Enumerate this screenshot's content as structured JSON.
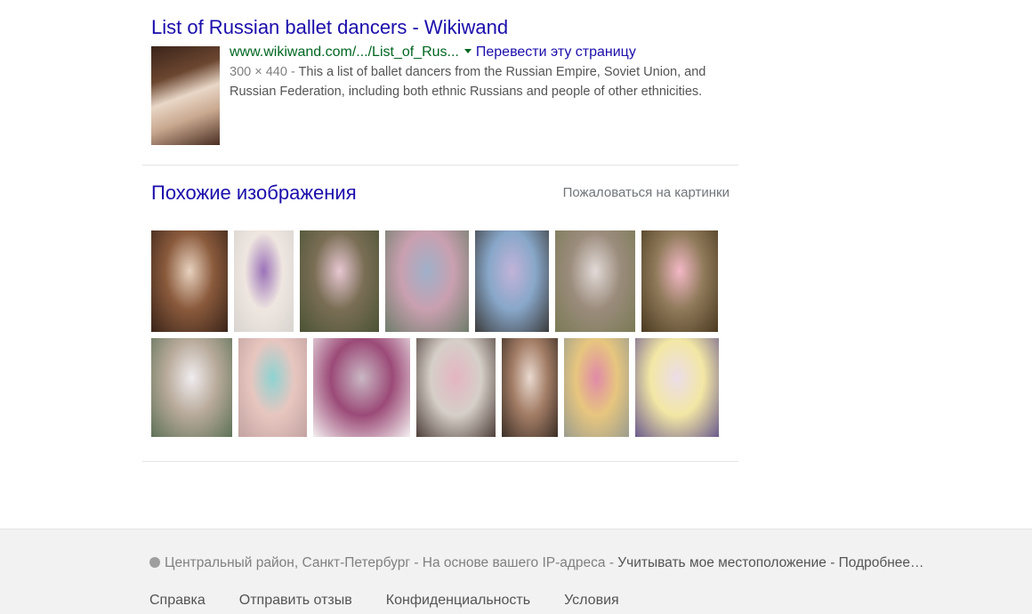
{
  "result": {
    "title": "List of Russian ballet dancers - Wikiwand",
    "url": "www.wikiwand.com/.../List_of_Rus...",
    "translate_label": "Перевести эту страницу",
    "dimensions": "300 × 440",
    "separator": " - ",
    "snippet": "This a list of ballet dancers from the Russian Empire, Soviet Union, and Russian Federation, including both ethnic Russians and people of other ethnicities."
  },
  "similar": {
    "title": "Похожие изображения",
    "report_label": "Пожаловаться на картинки",
    "row1": [
      {
        "name": "ballerina-thumb-1",
        "w": 86,
        "c": [
          "#3a2419",
          "#e8d2bf",
          "#8a5a3c"
        ]
      },
      {
        "name": "ballerina-thumb-2",
        "w": 67,
        "c": [
          "#d8d4d0",
          "#9b73b8",
          "#efe6e0"
        ]
      },
      {
        "name": "ballerina-thumb-3",
        "w": 89,
        "c": [
          "#4b5335",
          "#e7c7d2",
          "#7a6e55"
        ]
      },
      {
        "name": "ballerina-thumb-4",
        "w": 94,
        "c": [
          "#6f7d6b",
          "#9fb0c9",
          "#c9a0b0"
        ]
      },
      {
        "name": "ballerina-thumb-5",
        "w": 83,
        "c": [
          "#3b3b3b",
          "#c2b3d9",
          "#88a7c9"
        ]
      },
      {
        "name": "ballerina-thumb-6",
        "w": 90,
        "c": [
          "#7a7a55",
          "#e2dad8",
          "#9b8c7c"
        ]
      },
      {
        "name": "ballerina-thumb-7",
        "w": 86,
        "c": [
          "#4b3a20",
          "#f3b8c6",
          "#8f7a5a"
        ]
      }
    ],
    "row2": [
      {
        "name": "ballerina-thumb-8",
        "w": 91,
        "c": [
          "#5e7257",
          "#f0ecef",
          "#b8aa9a"
        ]
      },
      {
        "name": "ballerina-thumb-9",
        "w": 77,
        "c": [
          "#c2a3a0",
          "#8ed3d2",
          "#e8c6c0"
        ]
      },
      {
        "name": "ballerina-thumb-10",
        "w": 109,
        "c": [
          "#f4f0f0",
          "#c9b8c4",
          "#9b4a77"
        ]
      },
      {
        "name": "ballerina-thumb-11",
        "w": 89,
        "c": [
          "#4e3e3a",
          "#e4b5c2",
          "#d6cfc8"
        ]
      },
      {
        "name": "ballerina-thumb-12",
        "w": 63,
        "c": [
          "#3b2e25",
          "#e9d9cf",
          "#a37d66"
        ]
      },
      {
        "name": "ballerina-thumb-13",
        "w": 73,
        "c": [
          "#9b9d8e",
          "#e08aa8",
          "#e7c67f"
        ]
      },
      {
        "name": "ballerina-thumb-14",
        "w": 94,
        "c": [
          "#6a5a8e",
          "#ebdde8",
          "#f3e7a5"
        ]
      }
    ]
  },
  "footer": {
    "location": "Центральный район, Санкт-Петербург",
    "ip_text": " - На основе вашего IP-адреса - ",
    "use_location": "Учитывать мое местоположение",
    "more": " - Подробнее…",
    "links": [
      "Справка",
      "Отправить отзыв",
      "Конфиденциальность",
      "Условия"
    ]
  },
  "colors": {
    "link": "#1a0dab",
    "url": "#006621",
    "snippet": "#545454",
    "footer_bg": "#f2f2f2"
  }
}
